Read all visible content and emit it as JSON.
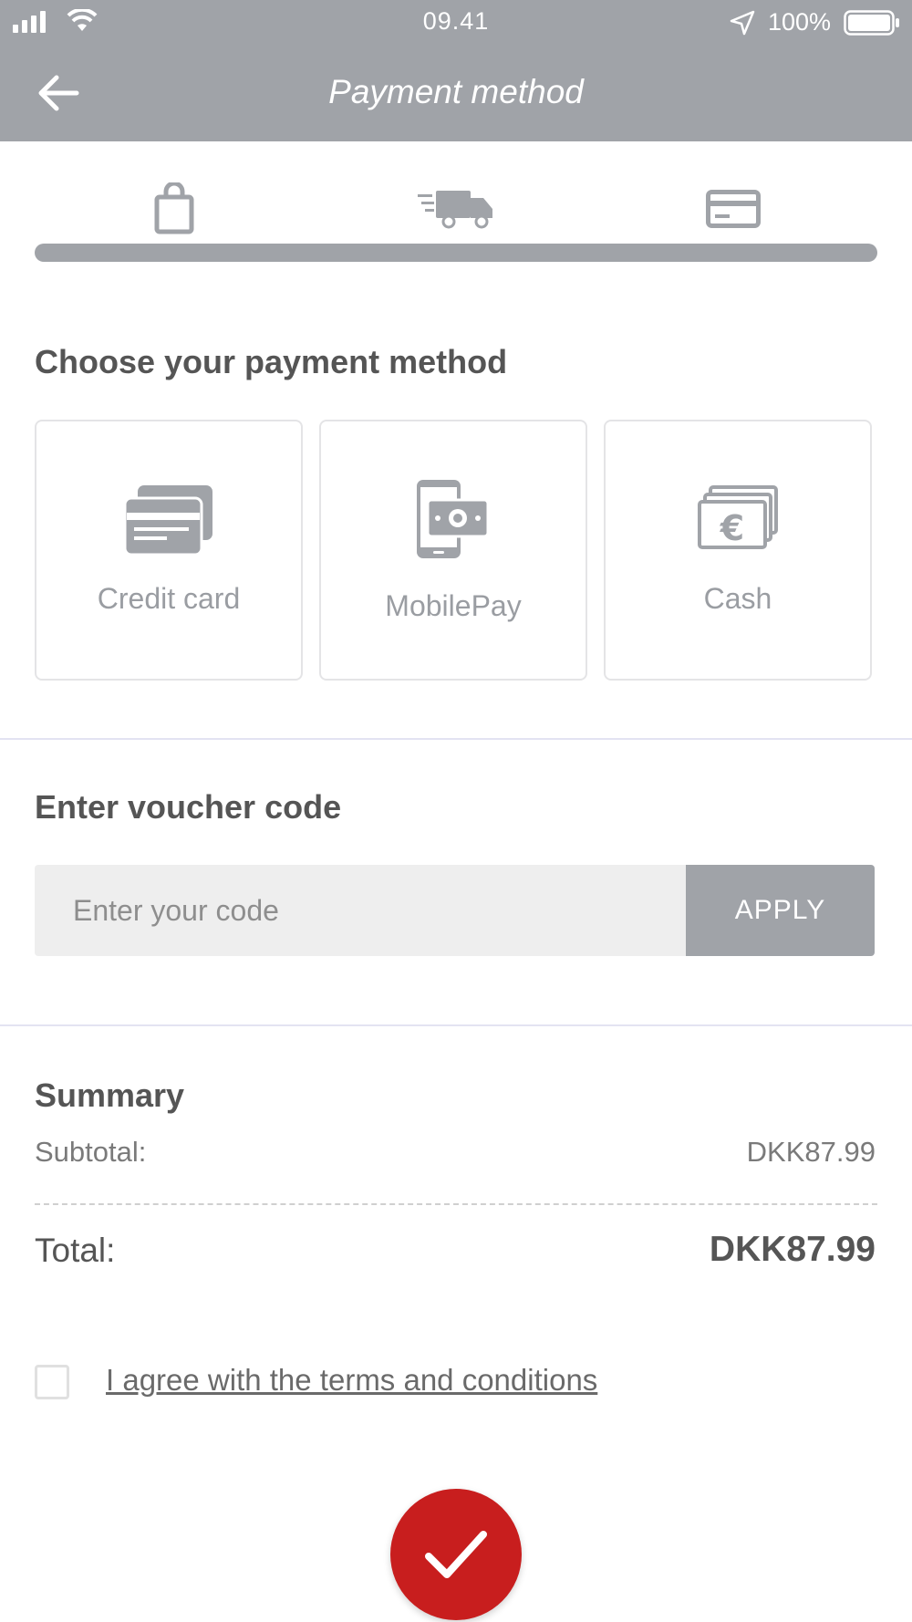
{
  "status_bar": {
    "time": "09.41",
    "battery_percent": "100%"
  },
  "app_bar": {
    "title": "Payment method"
  },
  "checkout_steps": {
    "icons": [
      "shopping-bag-icon",
      "delivery-truck-icon",
      "credit-card-icon"
    ],
    "progress": 1.0
  },
  "payment_section": {
    "heading": "Choose your payment method",
    "methods": [
      {
        "label": "Credit card",
        "icon": "credit-card-icon"
      },
      {
        "label": "MobilePay",
        "icon": "mobilepay-icon"
      },
      {
        "label": "Cash",
        "icon": "cash-euro-icon"
      }
    ]
  },
  "voucher_section": {
    "heading": "Enter voucher code",
    "placeholder": "Enter your code",
    "apply_label": "APPLY"
  },
  "summary": {
    "heading": "Summary",
    "subtotal_label": "Subtotal:",
    "subtotal_value": "DKK87.99",
    "total_label": "Total:",
    "total_value": "DKK87.99"
  },
  "terms": {
    "label": "I agree with the terms and conditions",
    "checked": false
  },
  "colors": {
    "header": "#a0a3a8",
    "confirm": "#c81e1e",
    "divider": "#e3e3f2"
  }
}
